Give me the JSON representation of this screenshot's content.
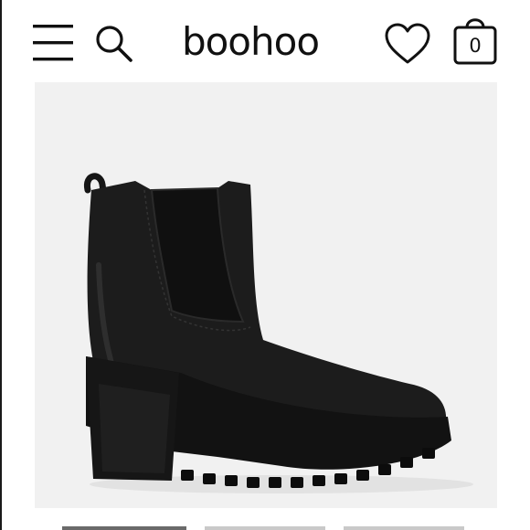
{
  "header": {
    "brand": "boohoo",
    "icons": {
      "menu": "hamburger-menu-icon",
      "search": "search-icon",
      "wishlist": "heart-icon",
      "bag": "shopping-bag-icon"
    },
    "bag_count": "0"
  },
  "product": {
    "image": "black-chelsea-ankle-boot"
  },
  "gallery": {
    "thumbnails": 3,
    "active_index": 0
  }
}
